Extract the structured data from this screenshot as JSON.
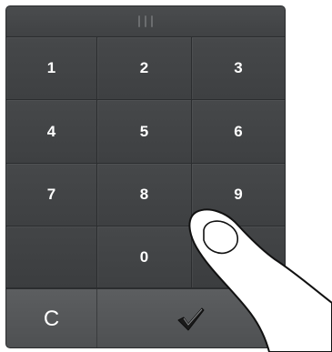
{
  "keypad": {
    "handle_icon": "grip-icon",
    "keys": [
      "1",
      "2",
      "3",
      "4",
      "5",
      "6",
      "7",
      "8",
      "9",
      "",
      "0",
      ""
    ],
    "clear_label": "C",
    "confirm_icon": "checkmark-icon"
  },
  "colors": {
    "key_background": "#3e4042",
    "key_text": "#ffffff",
    "bottom_row": "#55575a"
  }
}
